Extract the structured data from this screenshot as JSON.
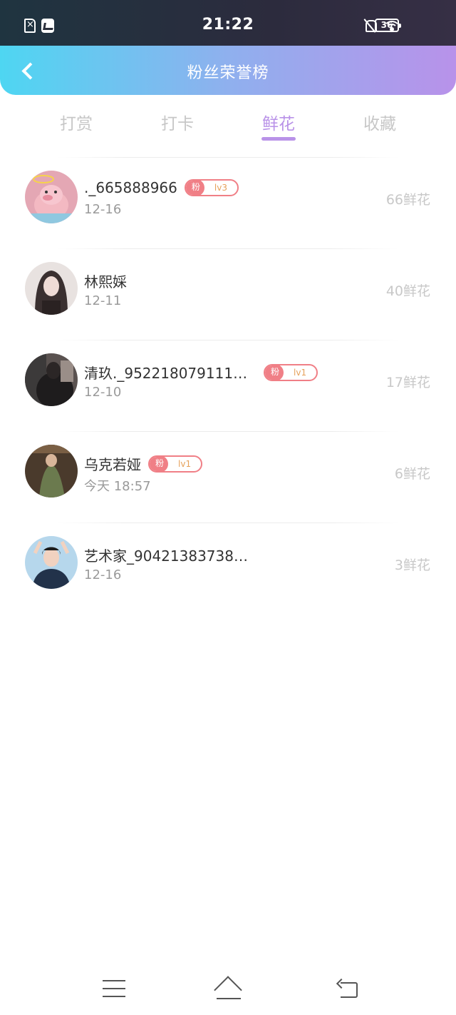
{
  "status_bar": {
    "time": "21:22",
    "battery": "36",
    "icons": [
      "sim-error-icon",
      "message-icon",
      "bell-off-icon",
      "wifi-icon",
      "battery-icon"
    ]
  },
  "header": {
    "title": "粉丝荣誉榜",
    "back_icon": "chevron-left-icon"
  },
  "tabs": [
    {
      "label": "打赏",
      "active": false
    },
    {
      "label": "打卡",
      "active": false
    },
    {
      "label": "鲜花",
      "active": true
    },
    {
      "label": "收藏",
      "active": false
    }
  ],
  "colors": {
    "accent": "#b992e8",
    "header_gradient_start": "#4ed6f2",
    "header_gradient_end": "#b892ea",
    "badge": "#f07f86",
    "badge_level_text": "#e6a15a"
  },
  "fans": [
    {
      "name": "._665888966",
      "date": "12-16",
      "count": "66鲜花",
      "badge": {
        "fan": "粉",
        "level": "lv3"
      }
    },
    {
      "name": "林熙婇",
      "date": "12-11",
      "count": "40鲜花",
      "badge": null
    },
    {
      "name": "清玖._9522180791114…",
      "date": "12-10",
      "count": "17鲜花",
      "badge": {
        "fan": "粉",
        "level": "lv1"
      }
    },
    {
      "name": "乌克若娅",
      "date": "今天 18:57",
      "count": "6鲜花",
      "badge": {
        "fan": "粉",
        "level": "lv1"
      }
    },
    {
      "name": "艺术家_90421383738…",
      "date": "12-16",
      "count": "3鲜花",
      "badge": null
    }
  ],
  "nav_bar": {
    "icons": [
      "menu-icon",
      "home-icon",
      "back-icon"
    ]
  }
}
